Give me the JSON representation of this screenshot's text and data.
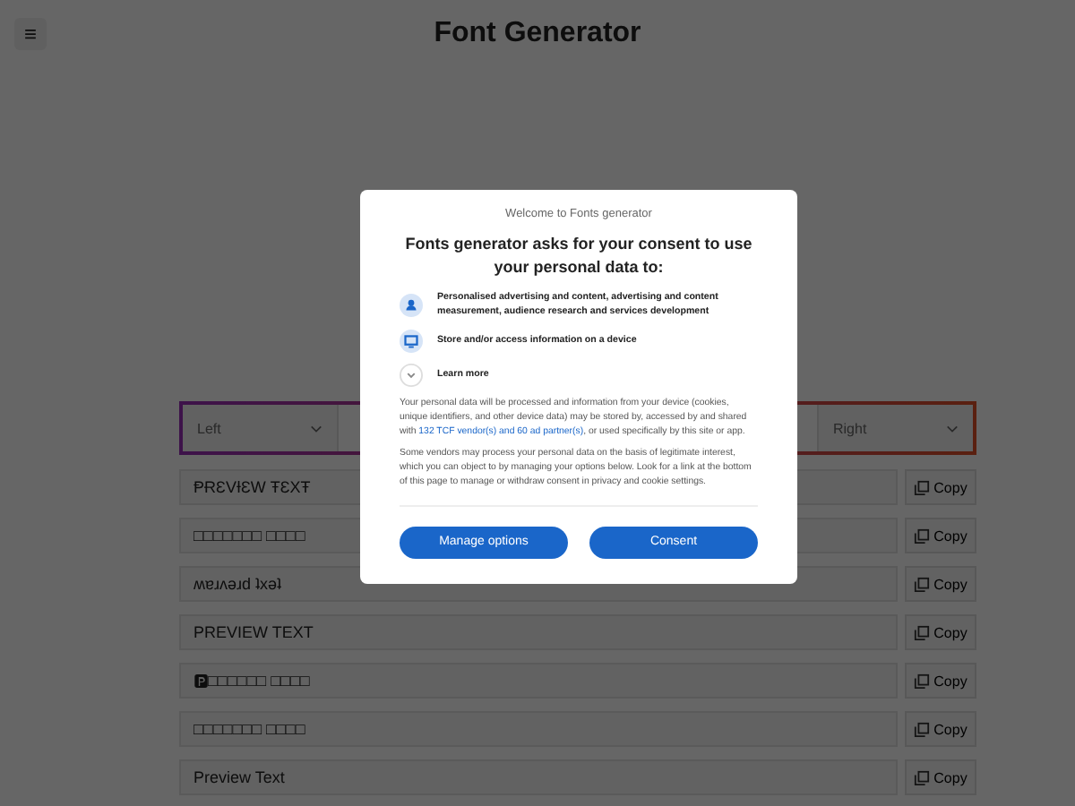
{
  "header": {
    "menu_icon": "≡",
    "title": "Font Generator"
  },
  "toolbar": {
    "align_left": "Left",
    "align_right": "Right"
  },
  "previews": [
    {
      "text": "ⱣɌƐVƗƐW ŦƐXŦ",
      "copy": "Copy"
    },
    {
      "text": "□□□□□□□ □□□□",
      "copy": "Copy"
    },
    {
      "text": "ʍɐɹʌǝɹd ʇxǝʇ",
      "copy": "Copy"
    },
    {
      "text": "PREVIEW TEXT",
      "copy": "Copy"
    },
    {
      "text": "🅿□□□□□□ □□□□",
      "copy": "Copy"
    },
    {
      "text": "□□□□□□□ □□□□",
      "copy": "Copy"
    },
    {
      "text": "Preview Text",
      "copy": "Copy"
    }
  ],
  "consent": {
    "welcome": "Welcome to Fonts generator",
    "heading": "Fonts generator asks for your consent to use your personal data to:",
    "purposes": [
      {
        "kind": "person",
        "text": "Personalised advertising and content, advertising and content measurement, audience research and services development"
      },
      {
        "kind": "device",
        "text": "Store and/or access information on a device"
      }
    ],
    "learn_more": "Learn more",
    "paragraphs": [
      {
        "before": "Your personal data will be processed and information from your device (cookies, unique identifiers, and other device data) may be stored by, accessed by and shared with ",
        "link": "132 TCF vendor(s) and 60 ad partner(s)",
        "after": ", or used specifically by this site or app."
      },
      {
        "before": "Some vendors may process your personal data on the basis of legitimate interest, which you can object to by managing your options below. Look for a link at the bottom of this page to manage or withdraw consent in privacy and cookie settings."
      }
    ],
    "buttons": [
      "Manage options",
      "Consent"
    ]
  }
}
